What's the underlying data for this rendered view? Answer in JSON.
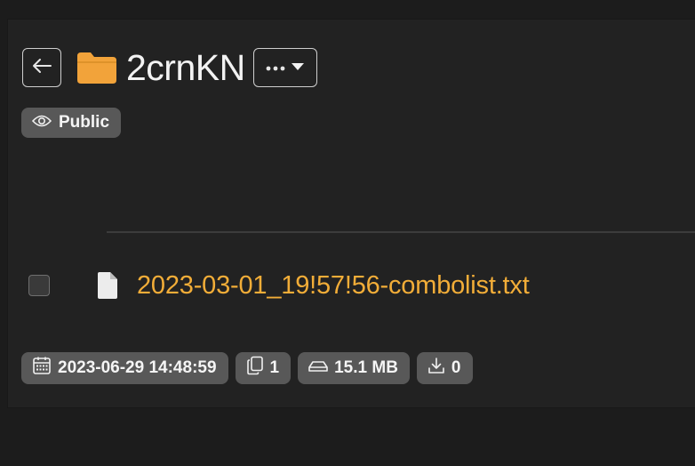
{
  "header": {
    "back_icon": "arrow-left-icon",
    "folder_icon": "folder-icon",
    "folder_color": "#f2a33a",
    "title": "2crnKN",
    "more_icon": "ellipsis-icon",
    "caret_icon": "caret-down-icon"
  },
  "visibility": {
    "icon": "eye-icon",
    "label": "Public"
  },
  "files": [
    {
      "checked": false,
      "icon": "file-icon",
      "name": "2023-03-01_19!57!56-combolist.txt",
      "link_color": "#f2ad38"
    }
  ],
  "meta": {
    "date": {
      "icon": "calendar-icon",
      "value": "2023-06-29 14:48:59"
    },
    "file_count": {
      "icon": "files-icon",
      "value": "1"
    },
    "size": {
      "icon": "drive-icon",
      "value": "15.1 MB"
    },
    "downloads": {
      "icon": "download-icon",
      "value": "0"
    }
  }
}
